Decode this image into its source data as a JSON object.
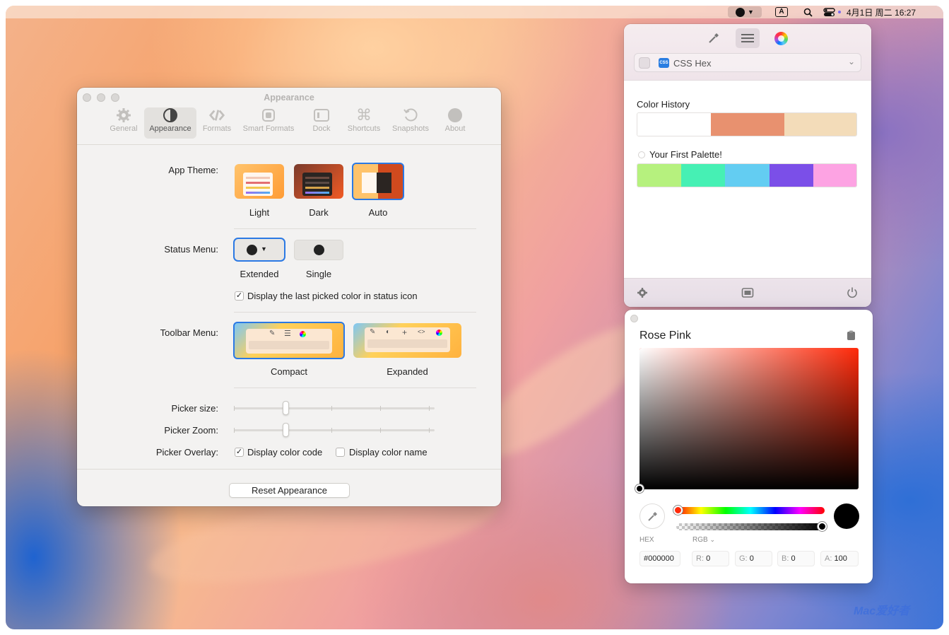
{
  "menubar": {
    "input_indicator": "A",
    "datetime": "4月1日 周二  16:27"
  },
  "prefs": {
    "title": "Appearance",
    "tabs": [
      {
        "label": "General",
        "icon": "gear-icon"
      },
      {
        "label": "Appearance",
        "icon": "half-circle-icon"
      },
      {
        "label": "Formats",
        "icon": "code-brackets-icon"
      },
      {
        "label": "Smart Formats",
        "icon": "smart-format-icon"
      },
      {
        "label": "Dock",
        "icon": "dock-icon"
      },
      {
        "label": "Shortcuts",
        "icon": "command-key-icon"
      },
      {
        "label": "Snapshots",
        "icon": "history-icon"
      },
      {
        "label": "About",
        "icon": "info-circle-icon"
      }
    ],
    "active_tab": "Appearance",
    "app_theme": {
      "label": "App Theme:",
      "options": [
        "Light",
        "Dark",
        "Auto"
      ],
      "selected": "Auto"
    },
    "status_menu": {
      "label": "Status Menu:",
      "options": [
        "Extended",
        "Single"
      ],
      "selected": "Extended",
      "checkbox_label": "Display the last picked color in status icon",
      "checkbox_checked": true
    },
    "toolbar_menu": {
      "label": "Toolbar Menu:",
      "options": [
        "Compact",
        "Expanded"
      ],
      "selected": "Compact"
    },
    "picker_size": {
      "label": "Picker size:",
      "level": 0.25
    },
    "picker_zoom": {
      "label": "Picker Zoom:",
      "level": 0.25
    },
    "picker_overlay": {
      "label": "Picker Overlay:",
      "color_code_label": "Display color code",
      "color_code_checked": true,
      "color_name_label": "Display color name",
      "color_name_checked": false
    },
    "reset_label": "Reset Appearance"
  },
  "popover": {
    "format_badge": "CSS",
    "format_label": "CSS Hex",
    "history_title": "Color History",
    "history_colors": [
      "#ffffff",
      "#e8916f",
      "#f3dcb9"
    ],
    "palette_title": "Your First Palette!",
    "palette_colors": [
      "#b6f17e",
      "#46f0b4",
      "#63cdf2",
      "#7b4fe8",
      "#fda3e3"
    ]
  },
  "panel": {
    "color_name": "Rose Pink",
    "hue_color": "#ff2a0a",
    "current_color": "#000000",
    "hex_label": "HEX",
    "model_label": "RGB",
    "hex_value": "#000000",
    "r_label": "R:",
    "r_value": "0",
    "g_label": "G:",
    "g_value": "0",
    "b_label": "B:",
    "b_value": "0",
    "a_label": "A:",
    "a_value": "100"
  },
  "watermark": "Mac爱好者"
}
